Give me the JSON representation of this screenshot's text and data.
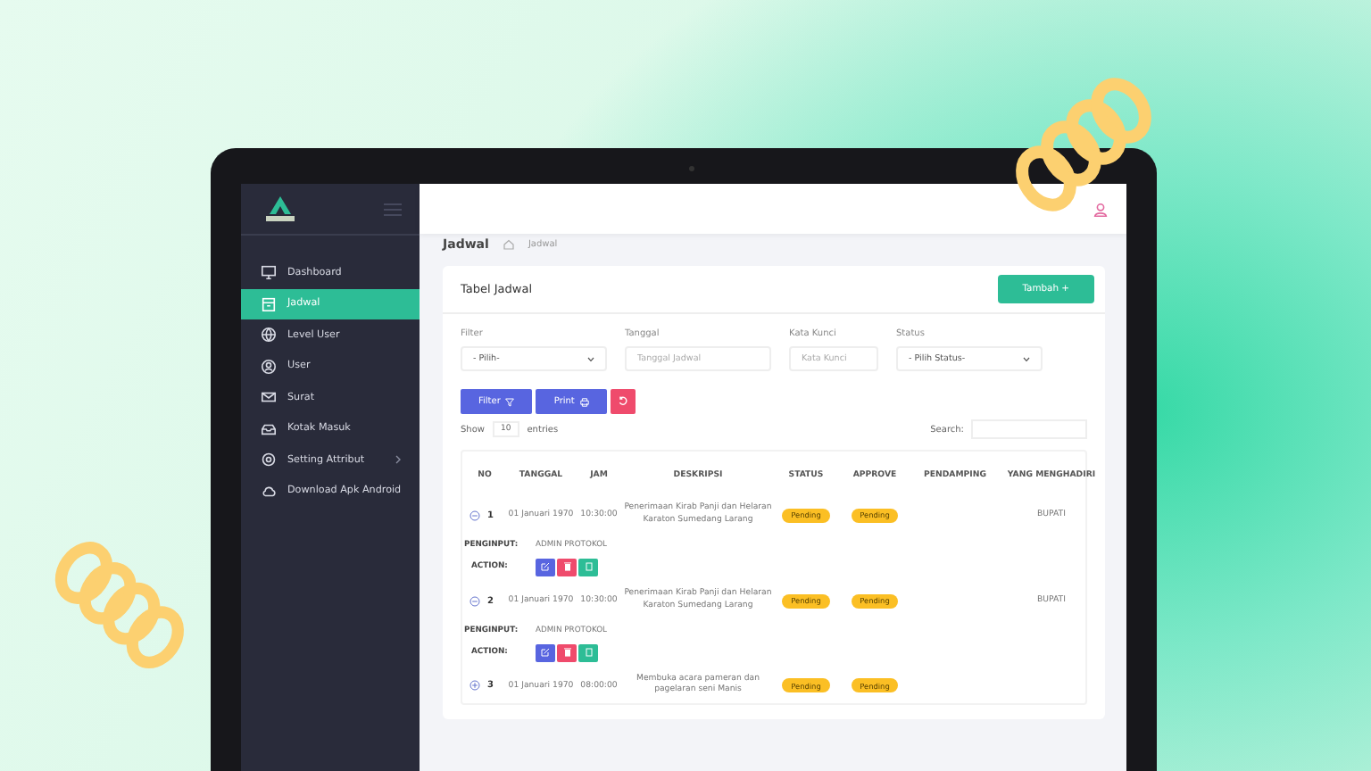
{
  "sidebar": {
    "items": [
      {
        "label": "Dashboard",
        "selected": false,
        "submenu": false
      },
      {
        "label": "Jadwal",
        "selected": true,
        "submenu": false
      },
      {
        "label": "Level User",
        "selected": false,
        "submenu": false
      },
      {
        "label": "User",
        "selected": false,
        "submenu": false
      },
      {
        "label": "Surat",
        "selected": false,
        "submenu": false
      },
      {
        "label": "Kotak Masuk",
        "selected": false,
        "submenu": false
      },
      {
        "label": "Setting Attribut",
        "selected": false,
        "submenu": true
      },
      {
        "label": "Download Apk Android",
        "selected": false,
        "submenu": false
      }
    ]
  },
  "breadcrumb": {
    "title": "Jadwal",
    "current": "Jadwal"
  },
  "card": {
    "title": "Tabel Jadwal",
    "add_button": "Tambah +"
  },
  "filters": [
    {
      "label": "Filter",
      "kind": "select",
      "value": "- Pilih-"
    },
    {
      "label": "Tanggal",
      "kind": "input",
      "placeholder": "Tanggal Jadwal"
    },
    {
      "label": "Kata Kunci",
      "kind": "input",
      "placeholder": "Kata Kunci"
    },
    {
      "label": "Status",
      "kind": "select",
      "value": "- Pilih Status-"
    }
  ],
  "buttons": {
    "filter": "Filter",
    "print": "Print"
  },
  "length": {
    "show": "Show",
    "value": "10",
    "entries": "entries"
  },
  "search": {
    "label": "Search:"
  },
  "table": {
    "columns": [
      "NO",
      "TANGGAL",
      "JAM",
      "DESKRIPSI",
      "STATUS",
      "APPROVE",
      "PENDAMPING",
      "YANG MENGHADIRI"
    ],
    "rows": [
      {
        "no": "1",
        "tanggal": "01 Januari 1970",
        "jam": "10:30:00",
        "deskripsi": "Penerimaan Kirab Panji dan Helaran Karaton Sumedang Larang",
        "status": "Pending",
        "approve": "Pending",
        "menghadiri": "BUPATI",
        "expanded": true,
        "penginput_label": "PENGINPUT:",
        "penginput": "ADMIN PROTOKOL",
        "action_label": "ACTION:"
      },
      {
        "no": "2",
        "tanggal": "01 Januari 1970",
        "jam": "10:30:00",
        "deskripsi": "Penerimaan Kirab Panji dan Helaran Karaton Sumedang Larang",
        "status": "Pending",
        "approve": "Pending",
        "menghadiri": "BUPATI",
        "expanded": true,
        "penginput_label": "PENGINPUT:",
        "penginput": "ADMIN PROTOKOL",
        "action_label": "ACTION:"
      },
      {
        "no": "3",
        "tanggal": "01 Januari 1970",
        "jam": "08:00:00",
        "deskripsi": "Membuka acara pameran dan pagelaran seni Manis",
        "status": "Pending",
        "approve": "Pending",
        "menghadiri": "",
        "expanded": false
      }
    ]
  }
}
